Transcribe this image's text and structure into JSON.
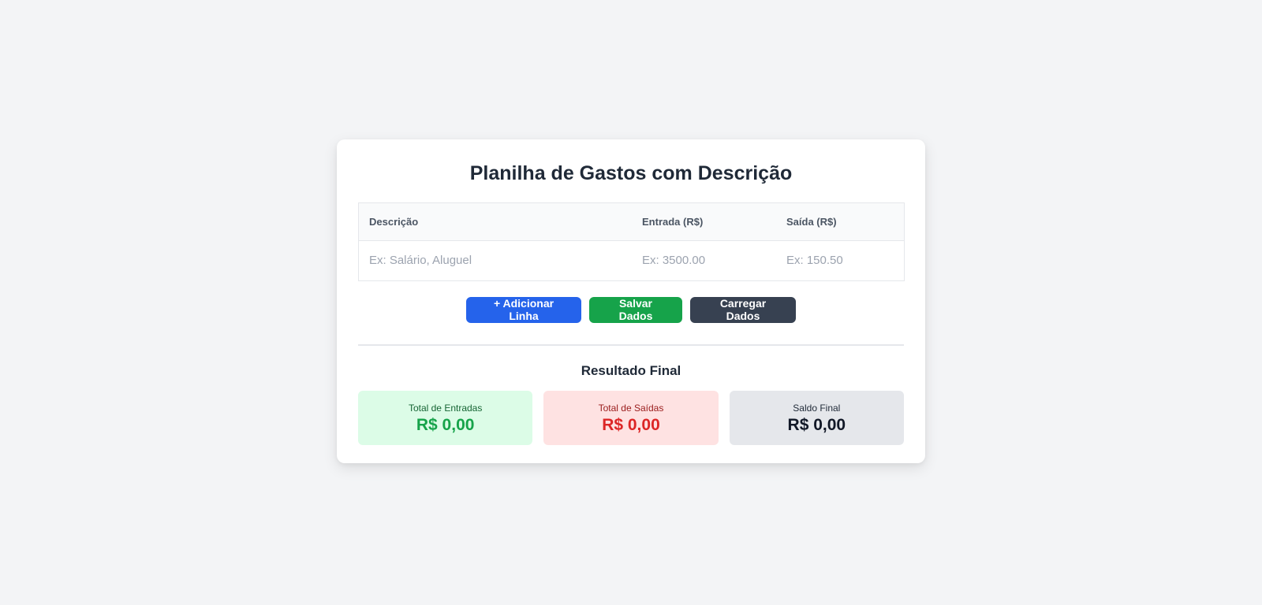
{
  "page": {
    "title": "Planilha de Gastos com Descrição"
  },
  "table": {
    "headers": {
      "description": "Descrição",
      "income": "Entrada (R$)",
      "expense": "Saída (R$)"
    },
    "rows": [
      {
        "description_value": "",
        "description_placeholder": "Ex: Salário, Aluguel",
        "income_value": "",
        "income_placeholder": "Ex: 3500.00",
        "expense_value": "",
        "expense_placeholder": "Ex: 150.50"
      }
    ]
  },
  "actions": {
    "add_row_label": "+ Adicionar Linha",
    "save_label": "Salvar Dados",
    "load_label": "Carregar Dados"
  },
  "results": {
    "title": "Resultado Final",
    "income_label": "Total de Entradas",
    "income_value": "R$ 0,00",
    "expense_label": "Total de Saídas",
    "expense_value": "R$ 0,00",
    "balance_label": "Saldo Final",
    "balance_value": "R$ 0,00"
  },
  "colors": {
    "primary_blue": "#2563eb",
    "success_green": "#16a34a",
    "dark_gray": "#374151",
    "danger_red": "#dc2626",
    "page_background": "#f3f4f6"
  }
}
